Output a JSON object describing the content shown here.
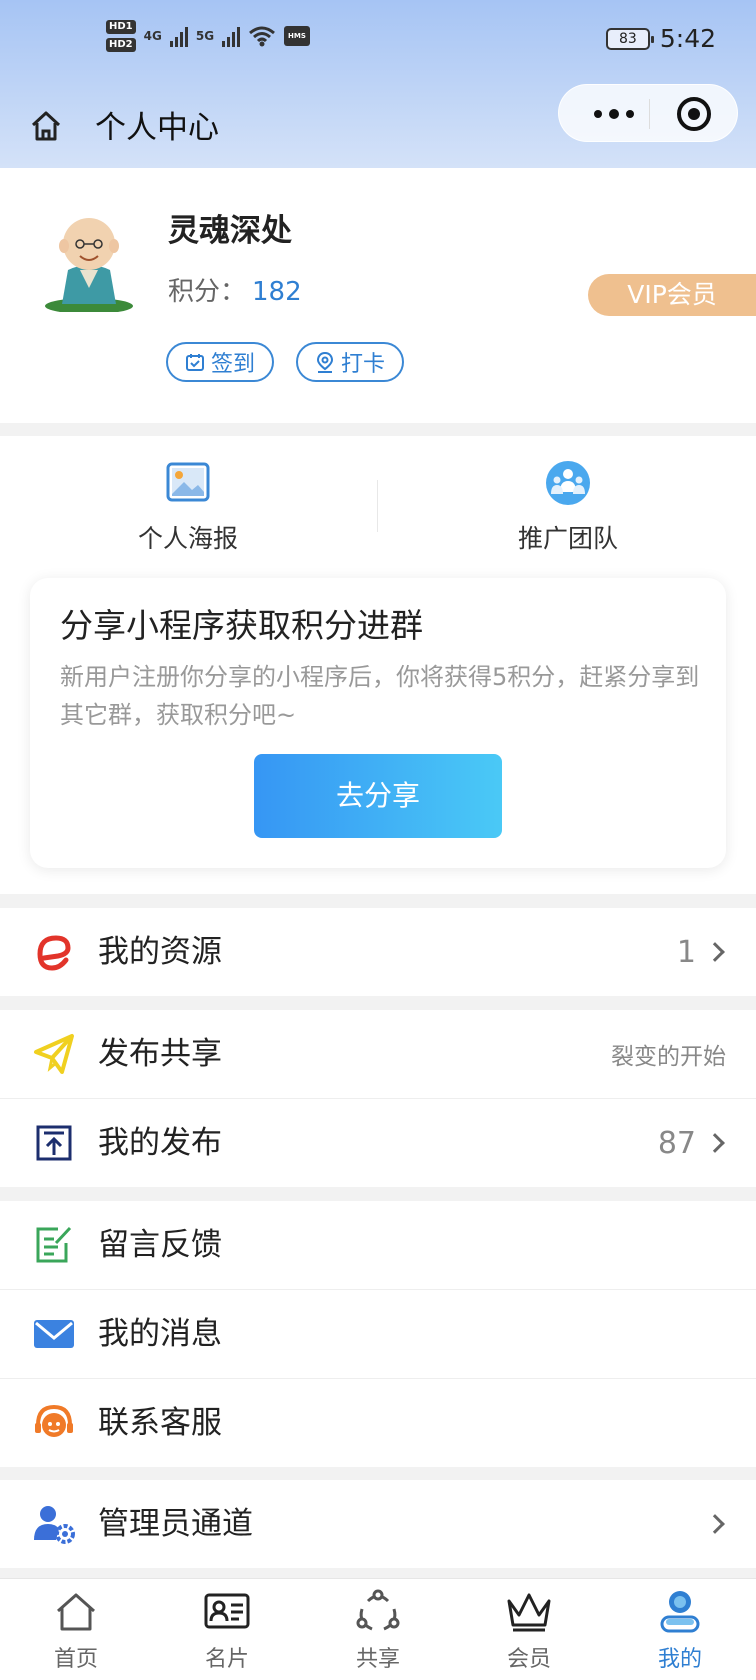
{
  "status_bar": {
    "hd1": "HD",
    "hd1_sub": "1",
    "hd2": "HD",
    "hd2_sub": "2",
    "net1": "4G",
    "net2": "5G",
    "nfc_badge": "HMS",
    "battery": "83",
    "time": "5:42"
  },
  "nav": {
    "title": "个人中心"
  },
  "profile": {
    "username": "灵魂深处",
    "points_label": "积分：",
    "points_value": "182",
    "vip_badge": "VIP会员",
    "signin_label": "签到",
    "checkin_label": "打卡"
  },
  "quick_actions": [
    {
      "label": "个人海报",
      "icon": "poster-image-icon"
    },
    {
      "label": "推广团队",
      "icon": "team-icon"
    }
  ],
  "share_card": {
    "title": "分享小程序获取积分进群",
    "description": "新用户注册你分享的小程序后，你将获得5积分，赶紧分享到其它群，获取积分吧~",
    "button": "去分享"
  },
  "menu": {
    "my_resources": {
      "label": "我的资源",
      "value": "1",
      "icon": "resource-e-icon"
    },
    "publish_share": {
      "label": "发布共享",
      "note": "裂变的开始",
      "icon": "paper-plane-icon"
    },
    "my_posts": {
      "label": "我的发布",
      "value": "87",
      "icon": "upload-box-icon"
    },
    "feedback": {
      "label": "留言反馈",
      "icon": "edit-note-icon"
    },
    "messages": {
      "label": "我的消息",
      "icon": "mail-icon"
    },
    "support": {
      "label": "联系客服",
      "icon": "headset-icon"
    },
    "admin": {
      "label": "管理员通道",
      "icon": "admin-gear-icon"
    }
  },
  "tabbar": [
    {
      "label": "首页",
      "icon": "home-icon"
    },
    {
      "label": "名片",
      "icon": "card-icon"
    },
    {
      "label": "共享",
      "icon": "share-cycle-icon"
    },
    {
      "label": "会员",
      "icon": "crown-icon"
    },
    {
      "label": "我的",
      "icon": "user-icon",
      "active": true
    }
  ],
  "colors": {
    "accent": "#2f7fd2",
    "vip": "#efc08f",
    "share_btn_start": "#3696f4",
    "share_btn_end": "#4ac9f6"
  }
}
